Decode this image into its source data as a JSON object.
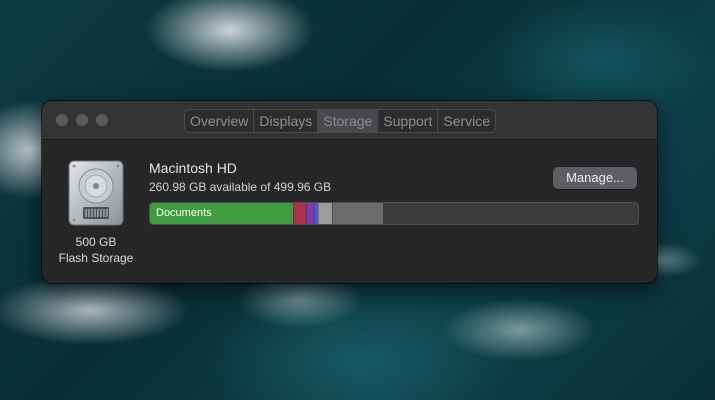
{
  "window": {
    "traffic_lights": [
      "close",
      "minimize",
      "zoom"
    ],
    "tabs": [
      {
        "label": "Overview",
        "active": false
      },
      {
        "label": "Displays",
        "active": false
      },
      {
        "label": "Storage",
        "active": true
      },
      {
        "label": "Support",
        "active": false
      },
      {
        "label": "Service",
        "active": false
      }
    ]
  },
  "disk": {
    "icon": "hard-drive-icon",
    "capacity_label": "500 GB",
    "type_label": "Flash Storage",
    "name": "Macintosh HD",
    "availability": "260.98 GB available of 499.96 GB"
  },
  "manage_button": {
    "label": "Manage..."
  },
  "storage_bar": {
    "segments": [
      {
        "name": "documents",
        "label": "Documents",
        "color": "#3f9c3f",
        "fraction": 0.293
      },
      {
        "name": "segment-red",
        "label": "",
        "color": "#a8344f",
        "fraction": 0.027
      },
      {
        "name": "segment-purple",
        "label": "",
        "color": "#7b3fa2",
        "fraction": 0.016
      },
      {
        "name": "segment-blue",
        "label": "",
        "color": "#5a55d8",
        "fraction": 0.008
      },
      {
        "name": "segment-gray-light",
        "label": "",
        "color": "#9b9c9e",
        "fraction": 0.029
      },
      {
        "name": "segment-gray",
        "label": "",
        "color": "#6b6c6e",
        "fraction": 0.103
      }
    ]
  },
  "colors": {
    "window_bg": "#262729",
    "titlebar_bg": "#333436",
    "accent_green": "#3f9c3f"
  }
}
